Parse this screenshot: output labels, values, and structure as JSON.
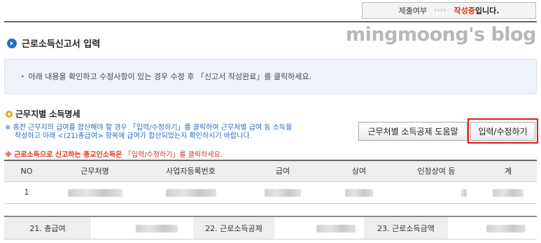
{
  "status": {
    "label": "제출여부",
    "arrows": "››››",
    "state": "작성중",
    "suffix": "입니다."
  },
  "watermark": "mingmoong's blog",
  "section": {
    "title": "근로소득신고서 입력"
  },
  "info": {
    "bullet": "•",
    "text": "아래 내용을 확인하고 수정사항이 있는 경우 수정 후 「신고서 작성완료」를 클릭하세요."
  },
  "workplace": {
    "title": "근무지별 소득명세",
    "notice_line1": "※ 종전 근무지의 급여를 합산해야 할 경우 「입력/수정하기」를 클릭하여 근무처별 급여 등 소득을",
    "notice_line2": "작성하고 아래 <(21)총급여> 항목에 급여가 합산되었는지 확인하시기 바랍니다.",
    "red_notice_prefix": "※ 근로소득으로 신고하는 종교인소득",
    "red_notice_mid": "은 ",
    "red_notice_suffix": "「입력/수정하기」를 클릭하세요.",
    "help_button": "근무처별 소득공제 도움말",
    "edit_button": "입력/수정하기"
  },
  "table": {
    "headers": [
      "NO",
      "근무처명",
      "사업자등록번호",
      "급여",
      "상여",
      "인정상여 등",
      "계"
    ],
    "rows": [
      {
        "no": "1"
      }
    ]
  },
  "totals": {
    "total_salary_label": "21. 총급여",
    "deduction_label": "22. 근로소득공제",
    "income_amount_label": "23. 근로소득금액"
  },
  "colors": {
    "accent_red": "#e0321c",
    "notice_blue": "#2f66c4",
    "header_bg": "#eeeeee",
    "info_bg": "#eef3fa"
  }
}
